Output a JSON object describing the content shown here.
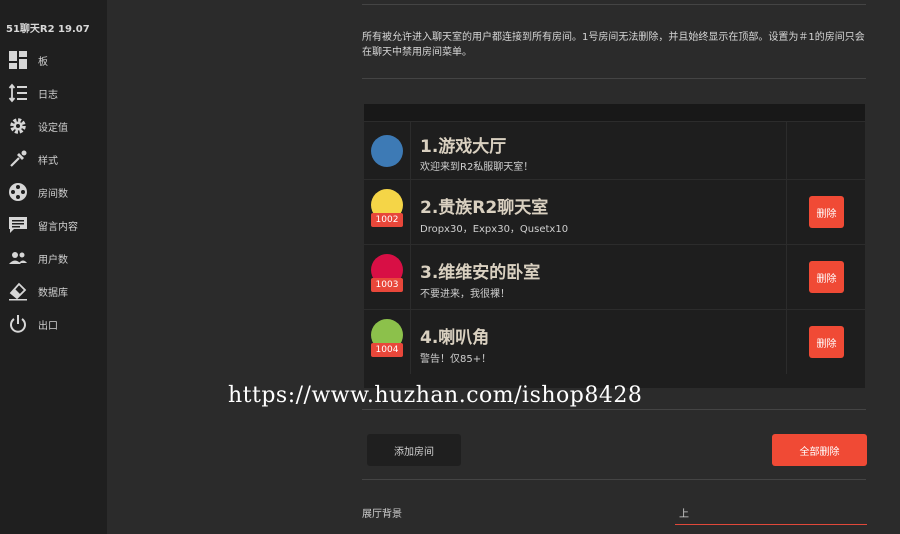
{
  "app": {
    "title": "51聊天R2 19.07"
  },
  "sidebar": {
    "items": [
      {
        "label": "板",
        "icon": "dashboard-icon"
      },
      {
        "label": "日志",
        "icon": "sort-list-icon"
      },
      {
        "label": "设定值",
        "icon": "gear-icon"
      },
      {
        "label": "样式",
        "icon": "eyedropper-icon"
      },
      {
        "label": "房间数",
        "icon": "film-reel-icon"
      },
      {
        "label": "留言内容",
        "icon": "chat-message-icon"
      },
      {
        "label": "用户数",
        "icon": "people-icon"
      },
      {
        "label": "数据库",
        "icon": "eraser-icon"
      },
      {
        "label": "出口",
        "icon": "power-icon"
      }
    ]
  },
  "main": {
    "description": "所有被允许进入聊天室的用户都连接到所有房间。1号房间无法删除，并且始终显示在顶部。设置为＃1的房间只会在聊天中禁用房间菜单。",
    "rooms": [
      {
        "name": "1.游戏大厅",
        "subtitle": "欢迎来到R2私服聊天室！",
        "color": "#3d7ab5",
        "badge": "",
        "delete_label": ""
      },
      {
        "name": "2.贵族R2聊天室",
        "subtitle": "Dropx30，Expx30，Qusetx10",
        "color": "#f5d547",
        "badge": "1002",
        "delete_label": "删除"
      },
      {
        "name": "3.维维安的卧室",
        "subtitle": "不要进来，我很裸！",
        "color": "#d80f45",
        "badge": "1003",
        "delete_label": "删除"
      },
      {
        "name": "4.喇叭角",
        "subtitle": "警告！仅85+！",
        "color": "#8cc14b",
        "badge": "1004",
        "delete_label": "删除"
      }
    ],
    "add_room_label": "添加房间",
    "delete_all_label": "全部删除",
    "background_label": "展厅背景",
    "background_value": "上"
  },
  "watermark": "https://www.huzhan.com/ishop8428",
  "colors": {
    "accent": "#f04a35",
    "sidebar_bg": "#1f1f1f",
    "main_bg": "#2b2b2b"
  }
}
